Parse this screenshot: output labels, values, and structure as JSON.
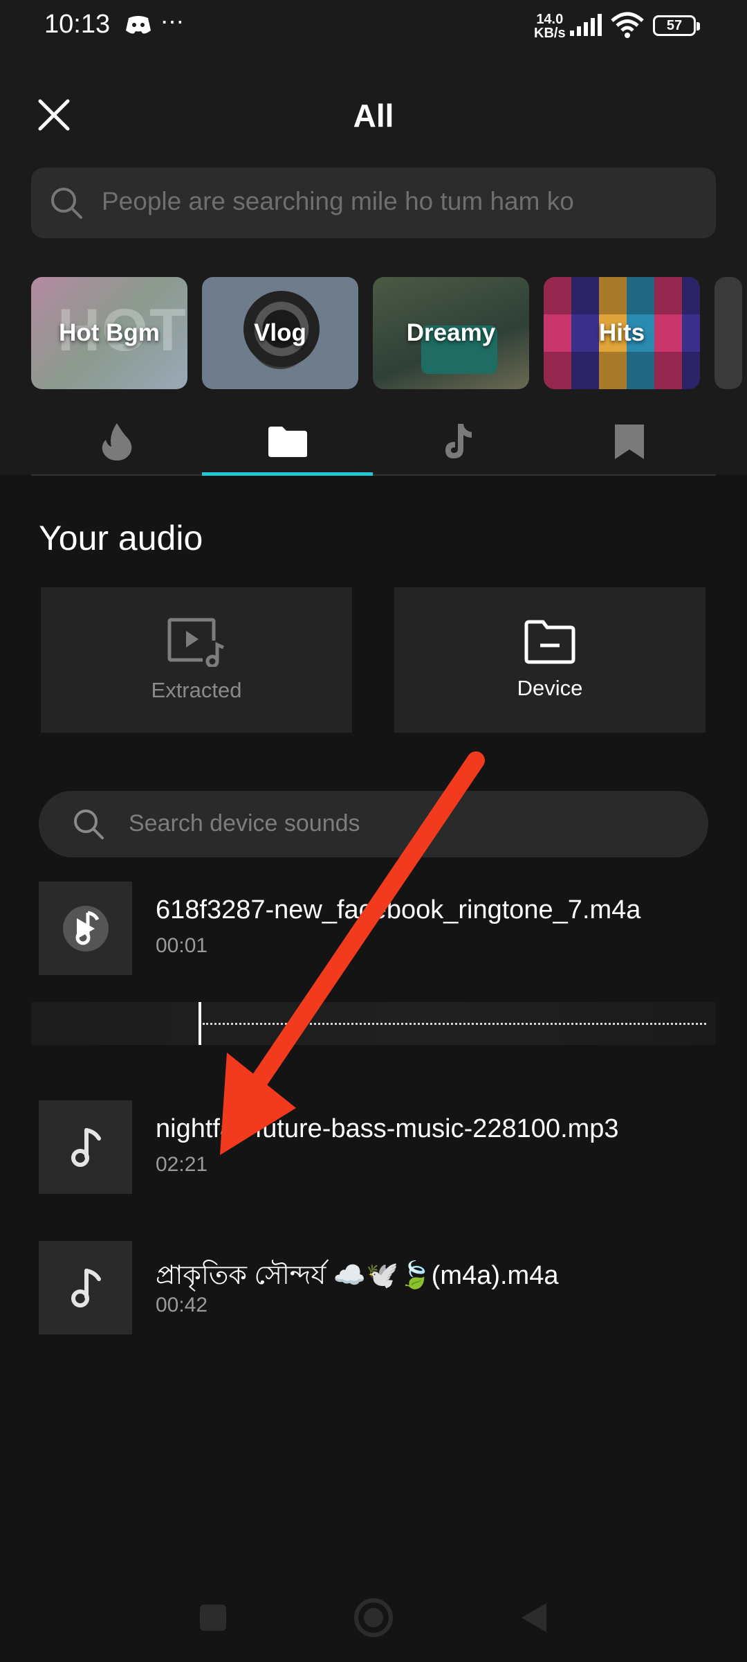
{
  "status_bar": {
    "time": "10:13",
    "more": "⋯",
    "net_speed_value": "14.0",
    "net_speed_unit": "KB/s",
    "battery": "57"
  },
  "header": {
    "title": "All",
    "search_placeholder": "People are searching mile ho tum ham ko"
  },
  "categories": [
    {
      "label": "Hot Bgm"
    },
    {
      "label": "Vlog"
    },
    {
      "label": "Dreamy"
    },
    {
      "label": "Hits"
    }
  ],
  "tabs": [
    {
      "icon": "flame-icon",
      "active": false
    },
    {
      "icon": "folder-icon",
      "active": true
    },
    {
      "icon": "tiktok-icon",
      "active": false
    },
    {
      "icon": "bookmark-icon",
      "active": false
    }
  ],
  "your_audio": {
    "title": "Your audio",
    "extracted_label": "Extracted",
    "device_label": "Device"
  },
  "device_search": {
    "placeholder": "Search device sounds"
  },
  "tracks": [
    {
      "name": "618f3287-new_facebook_ringtone_7.m4a",
      "duration": "00:01",
      "playing": true
    },
    {
      "name": "nightfall-future-bass-music-228100.mp3",
      "duration": "02:21",
      "playing": false
    },
    {
      "name": "প্রাকৃতিক সৌন্দর্য ☁️🕊️🍃(m4a).m4a",
      "duration": "00:42",
      "playing": false
    }
  ],
  "colors": {
    "accent": "#1fc8d2",
    "annotation_arrow": "#f23a1e",
    "background": "#141414"
  }
}
